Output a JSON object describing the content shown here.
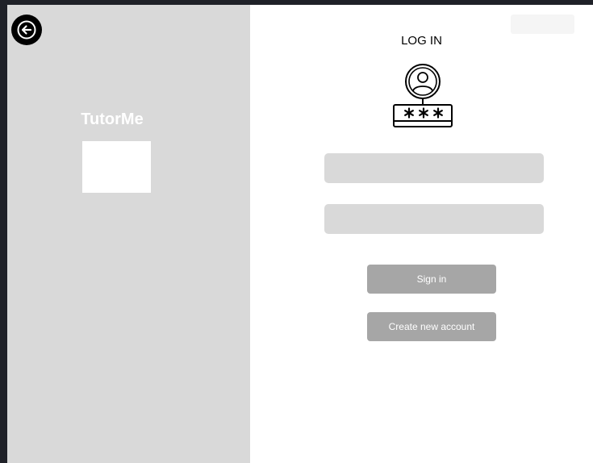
{
  "left_panel": {
    "brand": "TutorMe"
  },
  "form": {
    "heading": "LOG IN",
    "username_placeholder": "",
    "password_placeholder": "",
    "sign_in_label": "Sign in",
    "create_account_label": "Create new account"
  },
  "icons": {
    "back": "arrow-left-icon",
    "login": "user-password-icon"
  },
  "colors": {
    "panel": "#d9d9d9",
    "button": "#a6a6a6",
    "field": "#d9d9d9",
    "backdrop": "#1f2128"
  }
}
